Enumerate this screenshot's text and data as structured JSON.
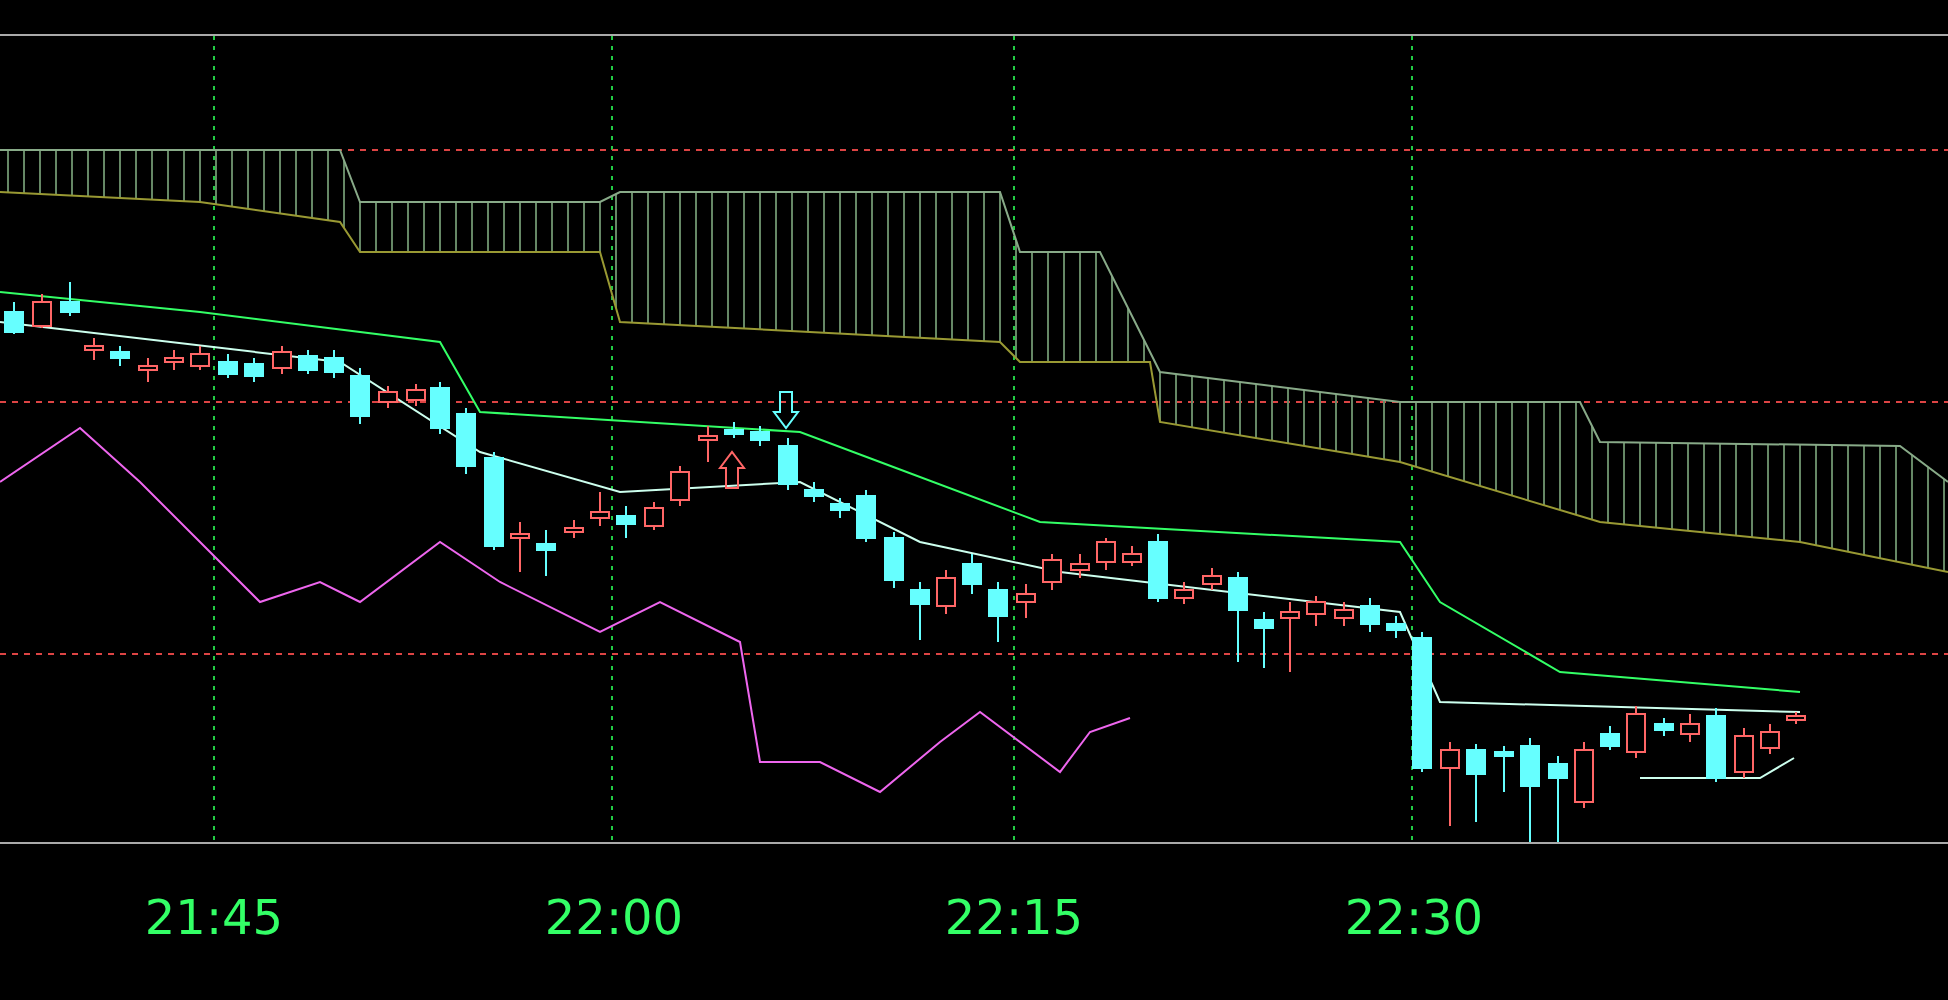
{
  "time_axis": {
    "labels": [
      "21:45",
      "22:00",
      "22:15",
      "22:30"
    ]
  }
}
